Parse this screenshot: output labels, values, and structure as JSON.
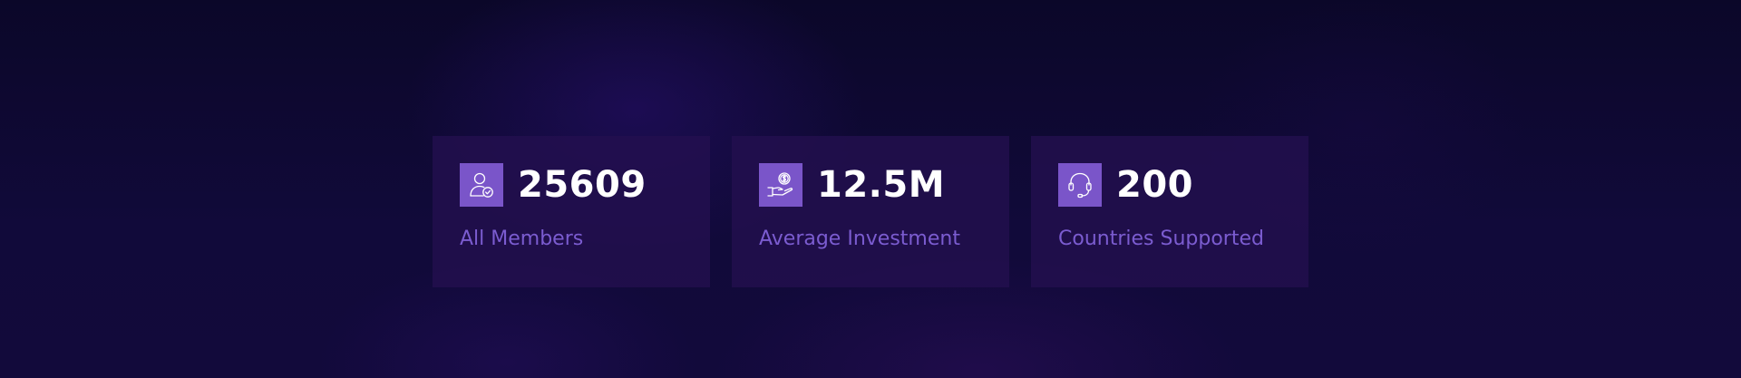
{
  "colors": {
    "background": "#0d0830",
    "card_background": "#241050",
    "icon_tile": "#7a55c9",
    "value_text": "#ffffff",
    "label_text": "#7b5cd0"
  },
  "stats": [
    {
      "icon": "member-verified-icon",
      "value": "25609",
      "label": "All Members"
    },
    {
      "icon": "investment-hand-coin-icon",
      "value": "12.5M",
      "label": "Average Investment"
    },
    {
      "icon": "headset-support-icon",
      "value": "200",
      "label": "Countries Supported"
    }
  ]
}
